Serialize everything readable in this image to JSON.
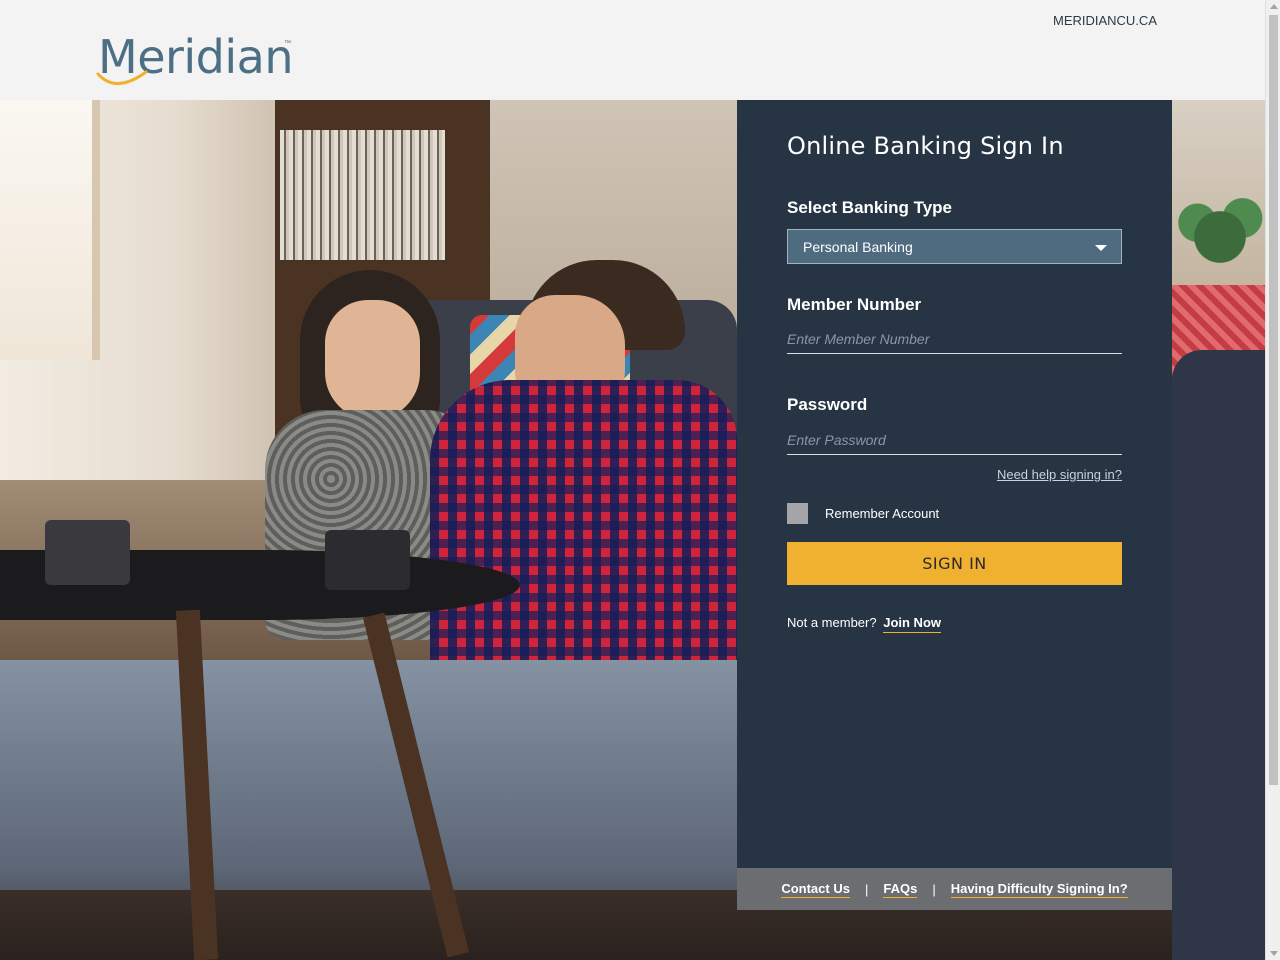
{
  "header": {
    "logo_text": "Meridian",
    "logo_tm": "™",
    "top_link": "MERIDIANCU.CA"
  },
  "signin": {
    "title": "Online Banking Sign In",
    "banking_type_label": "Select Banking Type",
    "banking_type_value": "Personal Banking",
    "member_number_label": "Member Number",
    "member_number_placeholder": "Enter Member Number",
    "password_label": "Password",
    "password_placeholder": "Enter Password",
    "help_link": "Need help signing in?",
    "remember_label": "Remember Account",
    "signin_button": "SIGN IN",
    "not_member_text": "Not a member?",
    "join_link": "Join Now"
  },
  "footer": {
    "contact": "Contact Us",
    "faqs": "FAQs",
    "difficulty": "Having Difficulty Signing In?",
    "separator": "|"
  },
  "colors": {
    "panel_bg": "#263443",
    "accent": "#f0b030",
    "select_bg": "#4e6b80",
    "footer_bg": "#6b6d70",
    "brand": "#4d6f86"
  }
}
